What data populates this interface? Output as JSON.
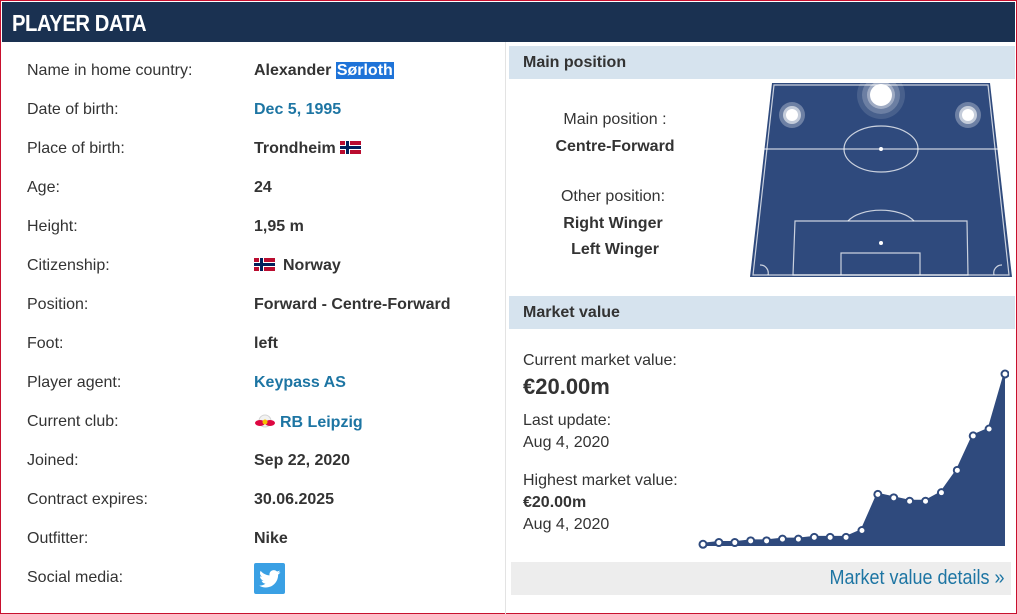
{
  "header": {
    "title": "PLAYER DATA"
  },
  "player": {
    "rows": [
      {
        "label": "Name in home country:",
        "value": "Alexander ",
        "value_highlight": "Sørloth"
      },
      {
        "label": "Date of birth:",
        "value": "Dec 5, 1995"
      },
      {
        "label": "Place of birth:",
        "value": "Trondheim"
      },
      {
        "label": "Age:",
        "value": "24"
      },
      {
        "label": "Height:",
        "value": "1,95 m"
      },
      {
        "label": "Citizenship:",
        "value": "Norway"
      },
      {
        "label": "Position:",
        "value": "Forward - Centre-Forward"
      },
      {
        "label": "Foot:",
        "value": "left"
      },
      {
        "label": "Player agent:",
        "value": "Keypass AS"
      },
      {
        "label": "Current club:",
        "value": "RB Leipzig"
      },
      {
        "label": "Joined:",
        "value": "Sep 22, 2020"
      },
      {
        "label": "Contract expires:",
        "value": "30.06.2025"
      },
      {
        "label": "Outfitter:",
        "value": "Nike"
      },
      {
        "label": "Social media:",
        "value": ""
      }
    ],
    "icons": {
      "flag": "norway-flag-icon",
      "club": "rb-leipzig-icon",
      "social": "twitter-icon"
    }
  },
  "position": {
    "section_title": "Main position",
    "main_label": "Main position :",
    "main_value": "Centre-Forward",
    "other_label": "Other position:",
    "other_values": [
      "Right Winger",
      "Left Winger"
    ],
    "pitch_color": "#2f4a7d",
    "highlighted": [
      "centre-forward",
      "right-winger",
      "left-winger"
    ]
  },
  "market": {
    "section_title": "Market value",
    "current_label": "Current market value:",
    "current_value": "€20.00m",
    "update_label": "Last update:",
    "update_date": "Aug 4, 2020",
    "highest_label": "Highest market value:",
    "highest_value": "€20.00m",
    "highest_date": "Aug 4, 2020",
    "details_link": "Market value details »",
    "trend": [
      0.01,
      0.02,
      0.02,
      0.03,
      0.03,
      0.04,
      0.04,
      0.05,
      0.05,
      0.05,
      0.09,
      0.3,
      0.28,
      0.26,
      0.26,
      0.31,
      0.44,
      0.64,
      0.68,
      1.0
    ]
  },
  "colors": {
    "header_bg": "#1a3151",
    "section_bg": "#d6e3ee",
    "link": "#1d75a3",
    "chart_fill": "#2f4a7d",
    "border": "#c8102e"
  }
}
